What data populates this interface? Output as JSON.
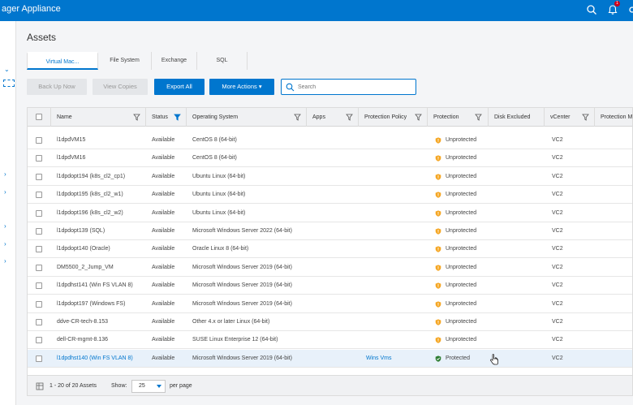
{
  "header": {
    "app_title": "ager Appliance",
    "notification_count": "1"
  },
  "page": {
    "title": "Assets"
  },
  "tabs": [
    {
      "label": "Virtual Mac..."
    },
    {
      "label": "File System"
    },
    {
      "label": "Exchange"
    },
    {
      "label": "SQL"
    }
  ],
  "toolbar": {
    "backup_label": "Back Up Now",
    "view_copies_label": "View Copies",
    "export_label": "Export All",
    "more_actions_label": "More Actions",
    "search_placeholder": "Search"
  },
  "columns": [
    {
      "label": "Name"
    },
    {
      "label": "Status"
    },
    {
      "label": "Operating System"
    },
    {
      "label": "Apps"
    },
    {
      "label": "Protection Policy"
    },
    {
      "label": "Protection"
    },
    {
      "label": "Disk Excluded"
    },
    {
      "label": "vCenter"
    },
    {
      "label": "Protection M"
    }
  ],
  "rows": [
    {
      "name": "l1dpdVM15",
      "status": "Available",
      "os": "CentOS 8 (64-bit)",
      "policy": "",
      "protection": "Unprotected",
      "vcenter": "VC2"
    },
    {
      "name": "l1dpdVM16",
      "status": "Available",
      "os": "CentOS 8 (64-bit)",
      "policy": "",
      "protection": "Unprotected",
      "vcenter": "VC2"
    },
    {
      "name": "l1dpdopt194 (k8s_cl2_cp1)",
      "status": "Available",
      "os": "Ubuntu Linux (64-bit)",
      "policy": "",
      "protection": "Unprotected",
      "vcenter": "VC2"
    },
    {
      "name": "l1dpdopt195 (k8s_cl2_w1)",
      "status": "Available",
      "os": "Ubuntu Linux (64-bit)",
      "policy": "",
      "protection": "Unprotected",
      "vcenter": "VC2"
    },
    {
      "name": "l1dpdopt196 (k8s_cl2_w2)",
      "status": "Available",
      "os": "Ubuntu Linux (64-bit)",
      "policy": "",
      "protection": "Unprotected",
      "vcenter": "VC2"
    },
    {
      "name": "l1dpdopt139 (SQL)",
      "status": "Available",
      "os": "Microsoft Windows Server 2022 (64-bit)",
      "policy": "",
      "protection": "Unprotected",
      "vcenter": "VC2"
    },
    {
      "name": "l1dpdopt140 (Oracle)",
      "status": "Available",
      "os": "Oracle Linux 8 (64-bit)",
      "policy": "",
      "protection": "Unprotected",
      "vcenter": "VC2"
    },
    {
      "name": "DM5500_2_Jump_VM",
      "status": "Available",
      "os": "Microsoft Windows Server 2019 (64-bit)",
      "policy": "",
      "protection": "Unprotected",
      "vcenter": "VC2"
    },
    {
      "name": "l1dpdhst141 (Win FS VLAN 8)",
      "status": "Available",
      "os": "Microsoft Windows Server 2019 (64-bit)",
      "policy": "",
      "protection": "Unprotected",
      "vcenter": "VC2"
    },
    {
      "name": "l1dpdopt197 (Windows FS)",
      "status": "Available",
      "os": "Microsoft Windows Server 2019 (64-bit)",
      "policy": "",
      "protection": "Unprotected",
      "vcenter": "VC2"
    },
    {
      "name": "ddve-CR-tech-8.153",
      "status": "Available",
      "os": "Other 4.x or later Linux (64-bit)",
      "policy": "",
      "protection": "Unprotected",
      "vcenter": "VC2"
    },
    {
      "name": "dell-CR-mgmt-8.136",
      "status": "Available",
      "os": "SUSE Linux Enterprise 12 (64-bit)",
      "policy": "",
      "protection": "Unprotected",
      "vcenter": "VC2"
    },
    {
      "name": "l1dpdhst140 (Win FS VLAN 8)",
      "status": "Available",
      "os": "Microsoft Windows Server 2019 (64-bit)",
      "policy": "Wins Vms",
      "protection": "Protected",
      "vcenter": "VC2"
    }
  ],
  "footer": {
    "count_text": "1 - 20 of 20 Assets",
    "show_label": "Show:",
    "page_size": "25",
    "per_page_label": "per page"
  },
  "colors": {
    "brand": "#0076ce",
    "warning": "#f5a623",
    "success": "#2e7d32"
  }
}
